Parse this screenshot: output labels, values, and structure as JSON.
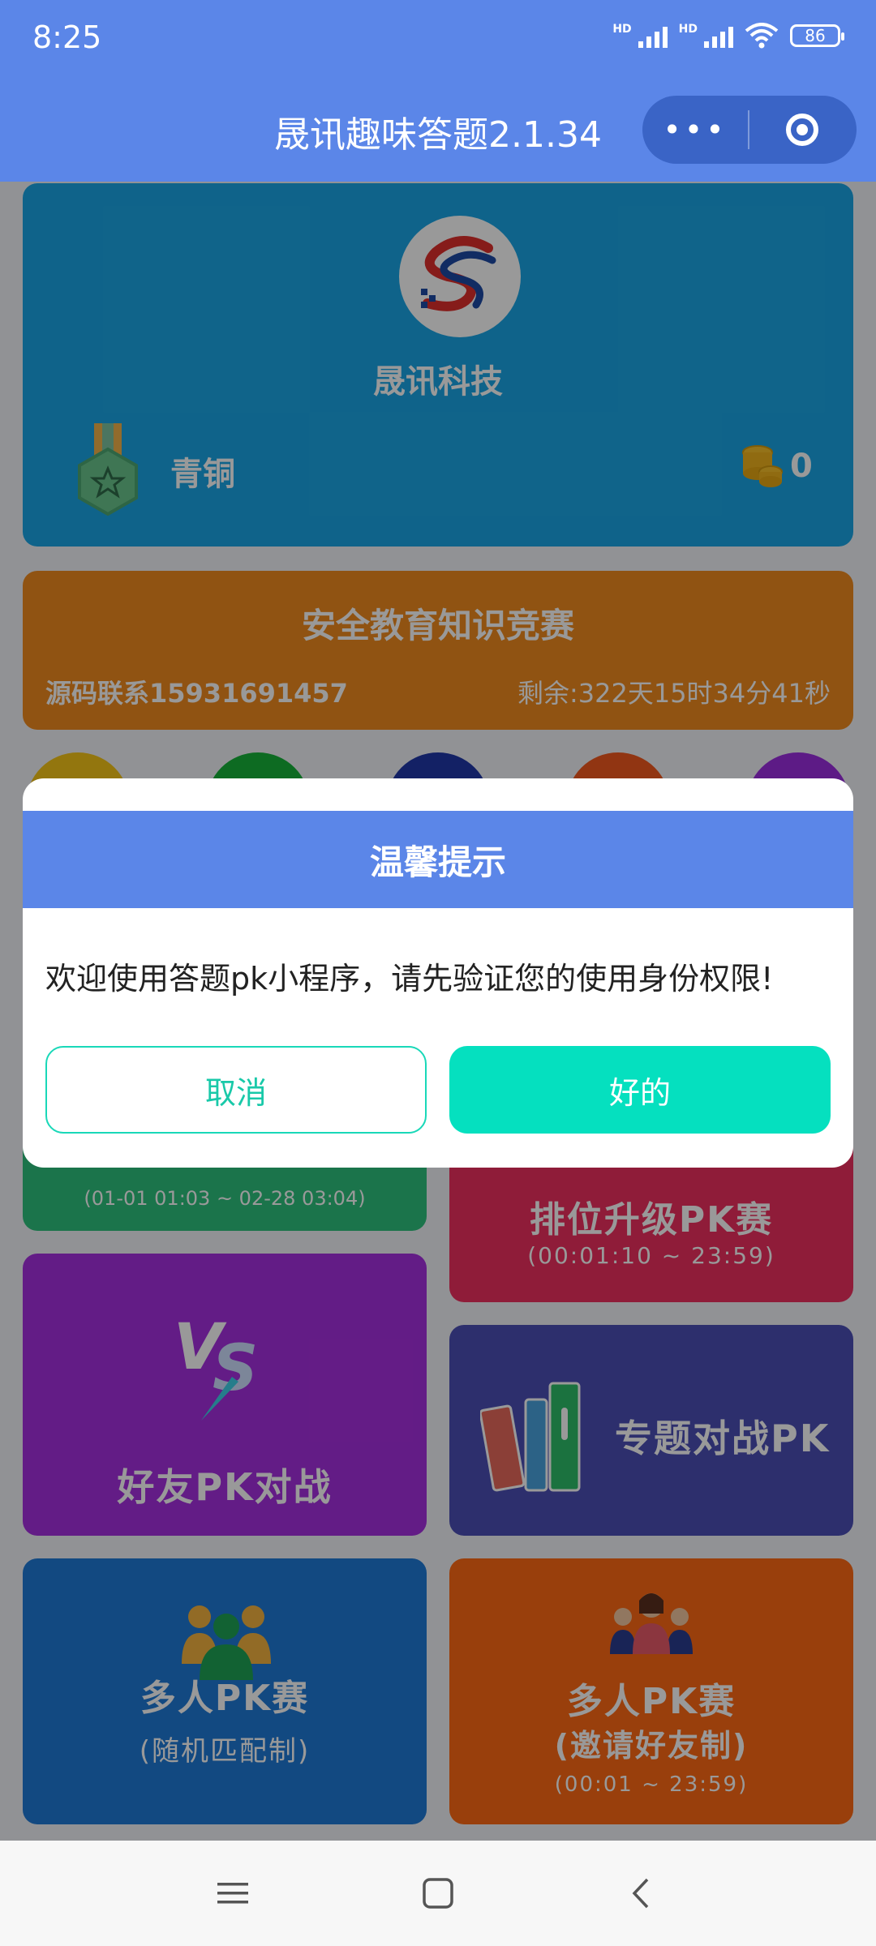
{
  "status_bar": {
    "time": "8:25",
    "network_1": "HD",
    "network_2": "HD",
    "battery": "86"
  },
  "navbar": {
    "title": "晟讯趣味答题2.1.34",
    "more_icon": "•••"
  },
  "profile": {
    "company": "晟讯科技",
    "rank": "青铜",
    "coins": "0"
  },
  "contest": {
    "title": "安全教育知识竞赛",
    "contact": "源码联系15931691457",
    "remaining": "剩余:322天15时34分41秒"
  },
  "tiles": {
    "daily_time": "(01-01 01:03 ~ 02-28 03:04)",
    "rank_title": "排位升级PK赛",
    "rank_time": "(00:01:10 ~ 23:59)",
    "friend_title": "好友PK对战",
    "topic_title": "专题对战PK",
    "multi_title": "多人PK赛",
    "multi_sub": "(随机匹配制)",
    "invite_title": "多人PK赛",
    "invite_sub": "(邀请好友制)",
    "invite_time": "(00:01 ~ 23:59)"
  },
  "dialog": {
    "title": "温馨提示",
    "message": "欢迎使用答题pk小程序，请先验证您的使用身份权限!",
    "cancel": "取消",
    "ok": "好的"
  },
  "colors": {
    "brand": "#5b86e8",
    "accent": "#05e0bf"
  }
}
